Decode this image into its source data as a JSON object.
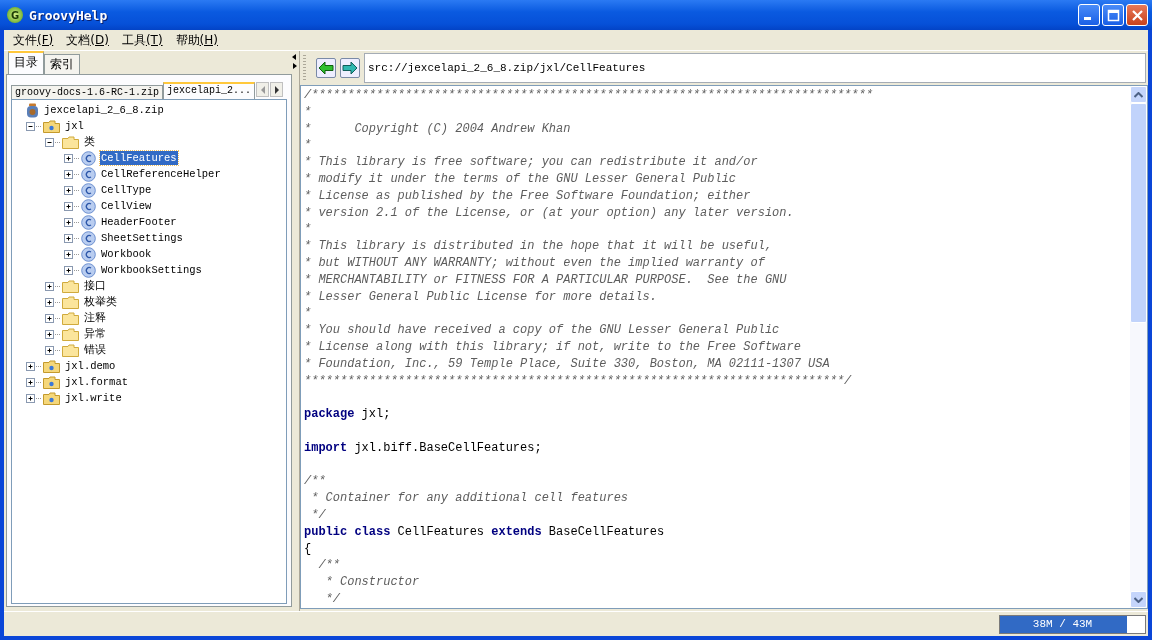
{
  "window": {
    "title": "GroovyHelp",
    "logo_letter": "G"
  },
  "menu": [
    {
      "label": "文件",
      "accel": "(F)"
    },
    {
      "label": "文档",
      "accel": "(D)"
    },
    {
      "label": "工具",
      "accel": "(T)"
    },
    {
      "label": "帮助",
      "accel": "(H)"
    }
  ],
  "nav_tabs": [
    {
      "label": "目录",
      "selected": true
    },
    {
      "label": "索引",
      "selected": false
    }
  ],
  "doc_tabs": [
    {
      "label": "groovy-docs-1.6-RC-1.zip",
      "selected": false
    },
    {
      "label": "jexcelapi_2...",
      "selected": true
    }
  ],
  "tree": [
    {
      "label": "jexcelapi_2_6_8.zip",
      "kind": "archive",
      "selected": false,
      "children": [
        {
          "label": "jxl",
          "kind": "package",
          "expanded": true,
          "selected": false,
          "children": [
            {
              "label": "类",
              "kind": "folder",
              "expanded": true,
              "selected": false,
              "children": [
                {
                  "label": "CellFeatures",
                  "kind": "class",
                  "expanded": false,
                  "selected": true
                },
                {
                  "label": "CellReferenceHelper",
                  "kind": "class",
                  "expanded": false,
                  "selected": false
                },
                {
                  "label": "CellType",
                  "kind": "class",
                  "expanded": false,
                  "selected": false
                },
                {
                  "label": "CellView",
                  "kind": "class",
                  "expanded": false,
                  "selected": false
                },
                {
                  "label": "HeaderFooter",
                  "kind": "class",
                  "expanded": false,
                  "selected": false
                },
                {
                  "label": "SheetSettings",
                  "kind": "class",
                  "expanded": false,
                  "selected": false
                },
                {
                  "label": "Workbook",
                  "kind": "class",
                  "expanded": false,
                  "selected": false
                },
                {
                  "label": "WorkbookSettings",
                  "kind": "class",
                  "expanded": false,
                  "selected": false
                }
              ]
            },
            {
              "label": "接口",
              "kind": "folder",
              "expanded": false,
              "selected": false
            },
            {
              "label": "枚举类",
              "kind": "folder",
              "expanded": false,
              "selected": false
            },
            {
              "label": "注释",
              "kind": "folder",
              "expanded": false,
              "selected": false
            },
            {
              "label": "异常",
              "kind": "folder",
              "expanded": false,
              "selected": false
            },
            {
              "label": "错误",
              "kind": "folder",
              "expanded": false,
              "selected": false
            }
          ]
        },
        {
          "label": "jxl.demo",
          "kind": "package",
          "expanded": false,
          "selected": false
        },
        {
          "label": "jxl.format",
          "kind": "package",
          "expanded": false,
          "selected": false
        },
        {
          "label": "jxl.write",
          "kind": "package",
          "expanded": false,
          "selected": false
        }
      ]
    }
  ],
  "address": {
    "value": "src://jexcelapi_2_6_8.zip/jxl/CellFeatures"
  },
  "code": [
    {
      "kind": "code",
      "tokens": [
        {
          "kind": "comment",
          "text": "/******************************************************************************"
        }
      ]
    },
    {
      "kind": "code",
      "tokens": [
        {
          "kind": "comment",
          "text": "*"
        }
      ]
    },
    {
      "kind": "code",
      "tokens": [
        {
          "kind": "comment",
          "text": "*      Copyright (C) 2004 Andrew Khan"
        }
      ]
    },
    {
      "kind": "code",
      "tokens": [
        {
          "kind": "comment",
          "text": "*"
        }
      ]
    },
    {
      "kind": "code",
      "tokens": [
        {
          "kind": "comment",
          "text": "* This library is free software; you can redistribute it and/or"
        }
      ]
    },
    {
      "kind": "code",
      "tokens": [
        {
          "kind": "comment",
          "text": "* modify it under the terms of the GNU Lesser General Public"
        }
      ]
    },
    {
      "kind": "code",
      "tokens": [
        {
          "kind": "comment",
          "text": "* License as published by the Free Software Foundation; either"
        }
      ]
    },
    {
      "kind": "code",
      "tokens": [
        {
          "kind": "comment",
          "text": "* version 2.1 of the License, or (at your option) any later version."
        }
      ]
    },
    {
      "kind": "code",
      "tokens": [
        {
          "kind": "comment",
          "text": "*"
        }
      ]
    },
    {
      "kind": "code",
      "tokens": [
        {
          "kind": "comment",
          "text": "* This library is distributed in the hope that it will be useful,"
        }
      ]
    },
    {
      "kind": "code",
      "tokens": [
        {
          "kind": "comment",
          "text": "* but WITHOUT ANY WARRANTY; without even the implied warranty of"
        }
      ]
    },
    {
      "kind": "code",
      "tokens": [
        {
          "kind": "comment",
          "text": "* MERCHANTABILITY or FITNESS FOR A PARTICULAR PURPOSE.  See the GNU"
        }
      ]
    },
    {
      "kind": "code",
      "tokens": [
        {
          "kind": "comment",
          "text": "* Lesser General Public License for more details."
        }
      ]
    },
    {
      "kind": "code",
      "tokens": [
        {
          "kind": "comment",
          "text": "*"
        }
      ]
    },
    {
      "kind": "code",
      "tokens": [
        {
          "kind": "comment",
          "text": "* You should have received a copy of the GNU Lesser General Public"
        }
      ]
    },
    {
      "kind": "code",
      "tokens": [
        {
          "kind": "comment",
          "text": "* License along with this library; if not, write to the Free Software"
        }
      ]
    },
    {
      "kind": "code",
      "tokens": [
        {
          "kind": "comment",
          "text": "* Foundation, Inc., 59 Temple Place, Suite 330, Boston, MA 02111-1307 USA"
        }
      ]
    },
    {
      "kind": "code",
      "tokens": [
        {
          "kind": "comment",
          "text": "***************************************************************************/"
        }
      ]
    },
    {
      "kind": "blank"
    },
    {
      "kind": "code",
      "tokens": [
        {
          "kind": "keyword",
          "text": "package"
        },
        {
          "kind": "plain",
          "text": " jxl;"
        }
      ]
    },
    {
      "kind": "blank"
    },
    {
      "kind": "code",
      "tokens": [
        {
          "kind": "keyword",
          "text": "import"
        },
        {
          "kind": "plain",
          "text": " jxl.biff.BaseCellFeatures;"
        }
      ]
    },
    {
      "kind": "blank"
    },
    {
      "kind": "code",
      "tokens": [
        {
          "kind": "comment",
          "text": "/**"
        }
      ]
    },
    {
      "kind": "code",
      "tokens": [
        {
          "kind": "comment",
          "text": " * Container for any additional cell features"
        }
      ]
    },
    {
      "kind": "code",
      "tokens": [
        {
          "kind": "comment",
          "text": " */"
        }
      ]
    },
    {
      "kind": "code",
      "tokens": [
        {
          "kind": "keyword",
          "text": "public class"
        },
        {
          "kind": "plain",
          "text": " CellFeatures "
        },
        {
          "kind": "keyword",
          "text": "extends"
        },
        {
          "kind": "plain",
          "text": " BaseCellFeatures"
        }
      ]
    },
    {
      "kind": "code",
      "tokens": [
        {
          "kind": "plain",
          "text": "{"
        }
      ]
    },
    {
      "kind": "code",
      "tokens": [
        {
          "kind": "comment",
          "text": "  /**"
        }
      ]
    },
    {
      "kind": "code",
      "tokens": [
        {
          "kind": "comment",
          "text": "   * Constructor"
        }
      ]
    },
    {
      "kind": "code",
      "tokens": [
        {
          "kind": "comment",
          "text": "   */"
        }
      ]
    }
  ],
  "status_bar": {
    "memory": {
      "level": 0.875,
      "reading": "38M / 43M"
    }
  }
}
